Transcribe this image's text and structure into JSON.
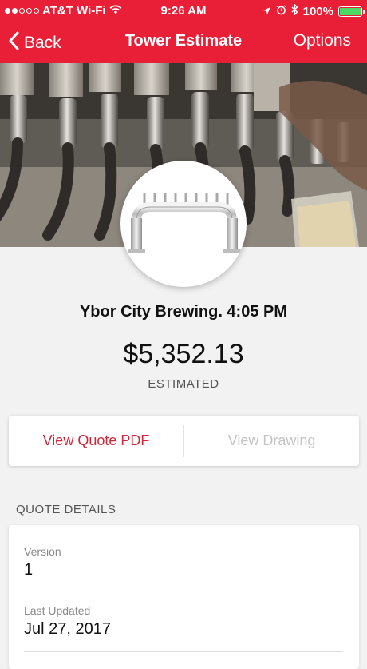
{
  "status_bar": {
    "carrier": "AT&T Wi-Fi",
    "time": "9:26 AM",
    "battery": "100%",
    "signal_icon": "signal-dots-icon",
    "wifi_icon": "wifi-icon",
    "battery_level": 1.0
  },
  "nav": {
    "back_label": "Back",
    "title": "Tower Estimate",
    "options_label": "Options"
  },
  "estimate": {
    "name_line": "Ybor City Brewing. 4:05 PM",
    "price": "$5,352.13",
    "price_label": "ESTIMATED"
  },
  "actions": {
    "view_quote": "View Quote PDF",
    "view_drawing": "View Drawing"
  },
  "details": {
    "section_title": "QUOTE DETAILS",
    "rows": [
      {
        "label": "Version",
        "value": "1"
      },
      {
        "label": "Last Updated",
        "value": "Jul 27, 2017"
      }
    ]
  },
  "colors": {
    "brand": "#e81f36",
    "link": "#d0283a",
    "disabled": "#c4c4c4",
    "background": "#f2f2f2"
  }
}
